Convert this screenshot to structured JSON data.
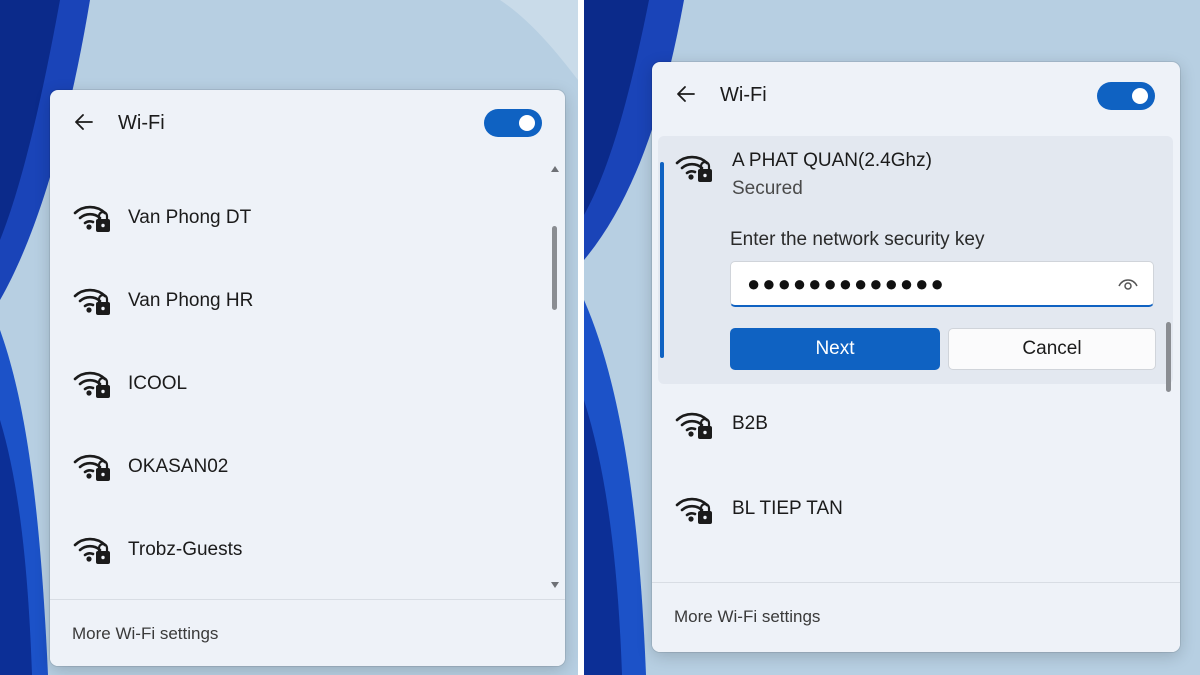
{
  "colors": {
    "accent": "#0f62c2",
    "panel": "#eef2f8"
  },
  "left_panel": {
    "title": "Wi-Fi",
    "wifi_toggle_on": true,
    "networks": [
      {
        "name": "Van Phong DT",
        "icon": "wifi-secured-icon"
      },
      {
        "name": "Van Phong HR",
        "icon": "wifi-secured-icon"
      },
      {
        "name": "ICOOL",
        "icon": "wifi-secured-icon"
      },
      {
        "name": "OKASAN02",
        "icon": "wifi-secured-icon"
      },
      {
        "name": "Trobz-Guests",
        "icon": "wifi-secured-icon"
      }
    ],
    "footer_link": "More Wi-Fi settings"
  },
  "right_panel": {
    "title": "Wi-Fi",
    "wifi_toggle_on": true,
    "selected_network": {
      "name": "A PHAT QUAN(2.4Ghz)",
      "status": "Secured",
      "key_prompt": "Enter the network security key",
      "key_value_masked": "●●●●●●●●●●●●●",
      "next_label": "Next",
      "cancel_label": "Cancel"
    },
    "networks": [
      {
        "name": "B2B",
        "icon": "wifi-secured-icon"
      },
      {
        "name": "BL TIEP TAN",
        "icon": "wifi-secured-icon"
      }
    ],
    "footer_link": "More Wi-Fi settings"
  }
}
